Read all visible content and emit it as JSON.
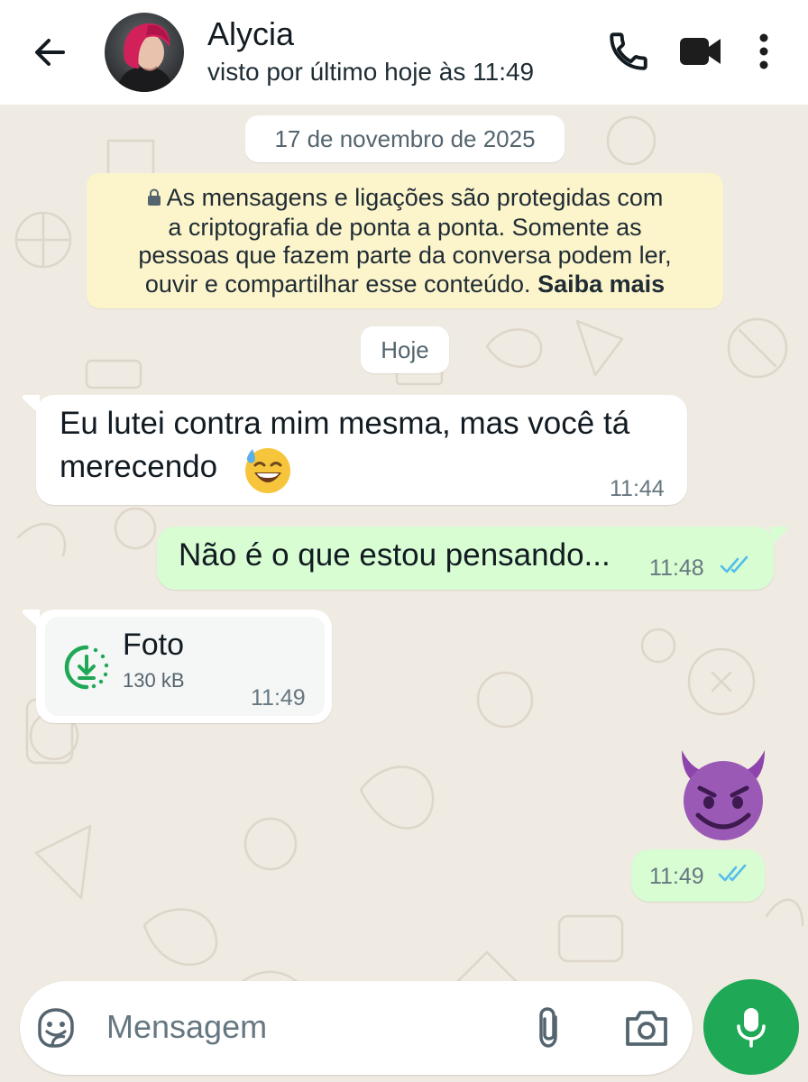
{
  "header": {
    "contact_name": "Alycia",
    "status": "visto por último hoje às 11:49",
    "icons": [
      "back-arrow-icon",
      "phone-icon",
      "video-camera-icon",
      "more-vertical-icon"
    ]
  },
  "chat": {
    "date_first": "17 de novembro de 2025",
    "encryption_notice": {
      "lines": [
        "As mensagens e ligações são protegidas com",
        "a criptografia de ponta a ponta. Somente as",
        "pessoas que fazem parte da conversa podem ler,",
        "ouvir e compartilhar esse conteúdo."
      ],
      "link": "Saiba mais"
    },
    "date_today": "Hoje",
    "messages": [
      {
        "direction": "incoming",
        "line1": "Eu lutei contra mim mesma, mas você tá",
        "line2": "merecendo",
        "emoji": "sweat-smile-emoji",
        "time": "11:44"
      },
      {
        "direction": "outgoing",
        "text": "Não é o que estou pensando...",
        "time": "11:48",
        "status": "read"
      },
      {
        "direction": "incoming",
        "type": "file",
        "file_name": "Foto",
        "file_size": "130 kB",
        "time": "11:49"
      },
      {
        "direction": "outgoing",
        "type": "emoji",
        "emoji": "smiling-devil-emoji",
        "time": "11:49",
        "status": "read"
      }
    ]
  },
  "composer": {
    "placeholder": "Mensagem",
    "icons": [
      "sticker-icon",
      "paperclip-icon",
      "camera-icon",
      "microphone-icon"
    ]
  },
  "colors": {
    "accent_green": "#1fa855",
    "outgoing_bubble": "#d9fdd3",
    "read_ticks": "#53bdeb",
    "encryption_bg": "#fcf4cb",
    "wallpaper": "#efeae2"
  }
}
